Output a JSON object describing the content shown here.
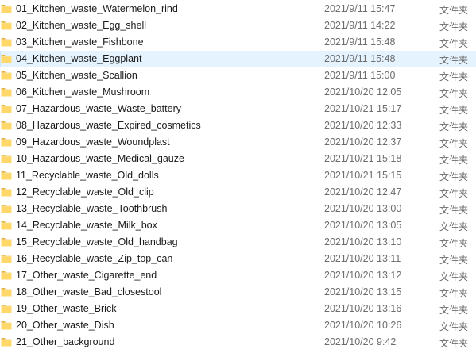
{
  "colors": {
    "selected_row_bg": "#e5f3ff",
    "folder_body": "#ffd869",
    "folder_tab": "#e5b33f",
    "secondary_text": "#6d6d6d"
  },
  "file_list": {
    "selected_index": 3,
    "rows": [
      {
        "name": "01_Kitchen_waste_Watermelon_rind",
        "date": "2021/9/11 15:47",
        "type": "文件夹",
        "icon": "folder-icon"
      },
      {
        "name": "02_Kitchen_waste_Egg_shell",
        "date": "2021/9/11 14:22",
        "type": "文件夹",
        "icon": "folder-icon"
      },
      {
        "name": "03_Kitchen_waste_Fishbone",
        "date": "2021/9/11 15:48",
        "type": "文件夹",
        "icon": "folder-icon"
      },
      {
        "name": "04_Kitchen_waste_Eggplant",
        "date": "2021/9/11 15:48",
        "type": "文件夹",
        "icon": "folder-icon"
      },
      {
        "name": "05_Kitchen_waste_Scallion",
        "date": "2021/9/11 15:00",
        "type": "文件夹",
        "icon": "folder-icon"
      },
      {
        "name": "06_Kitchen_waste_Mushroom",
        "date": "2021/10/20 12:05",
        "type": "文件夹",
        "icon": "folder-icon"
      },
      {
        "name": "07_Hazardous_waste_Waste_battery",
        "date": "2021/10/21 15:17",
        "type": "文件夹",
        "icon": "folder-icon"
      },
      {
        "name": "08_Hazardous_waste_Expired_cosmetics",
        "date": "2021/10/20 12:33",
        "type": "文件夹",
        "icon": "folder-icon"
      },
      {
        "name": "09_Hazardous_waste_Woundplast",
        "date": "2021/10/20 12:37",
        "type": "文件夹",
        "icon": "folder-icon"
      },
      {
        "name": "10_Hazardous_waste_Medical_gauze",
        "date": "2021/10/21 15:18",
        "type": "文件夹",
        "icon": "folder-icon"
      },
      {
        "name": "11_Recyclable_waste_Old_dolls",
        "date": "2021/10/21 15:15",
        "type": "文件夹",
        "icon": "folder-icon"
      },
      {
        "name": "12_Recyclable_waste_Old_clip",
        "date": "2021/10/20 12:47",
        "type": "文件夹",
        "icon": "folder-icon"
      },
      {
        "name": "13_Recyclable_waste_Toothbrush",
        "date": "2021/10/20 13:00",
        "type": "文件夹",
        "icon": "folder-icon"
      },
      {
        "name": "14_Recyclable_waste_Milk_box",
        "date": "2021/10/20 13:05",
        "type": "文件夹",
        "icon": "folder-icon"
      },
      {
        "name": "15_Recyclable_waste_Old_handbag",
        "date": "2021/10/20 13:10",
        "type": "文件夹",
        "icon": "folder-icon"
      },
      {
        "name": "16_Recyclable_waste_Zip_top_can",
        "date": "2021/10/20 13:11",
        "type": "文件夹",
        "icon": "folder-icon"
      },
      {
        "name": "17_Other_waste_Cigarette_end",
        "date": "2021/10/20 13:12",
        "type": "文件夹",
        "icon": "folder-icon"
      },
      {
        "name": "18_Other_waste_Bad_closestool",
        "date": "2021/10/20 13:15",
        "type": "文件夹",
        "icon": "folder-icon"
      },
      {
        "name": "19_Other_waste_Brick",
        "date": "2021/10/20 13:16",
        "type": "文件夹",
        "icon": "folder-icon"
      },
      {
        "name": "20_Other_waste_Dish",
        "date": "2021/10/20 10:26",
        "type": "文件夹",
        "icon": "folder-icon"
      },
      {
        "name": "21_Other_background",
        "date": "2021/10/20 9:42",
        "type": "文件夹",
        "icon": "folder-icon"
      }
    ]
  }
}
